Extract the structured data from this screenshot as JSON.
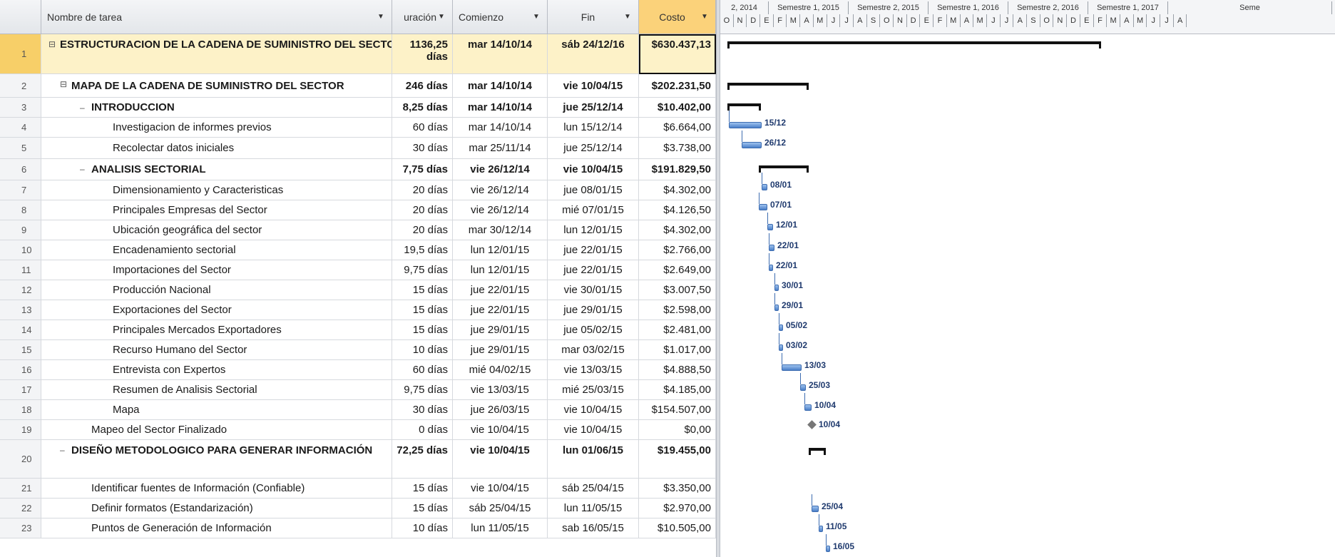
{
  "columns": {
    "id": "",
    "name": "Nombre de tarea",
    "duracion": "uración",
    "comienzo": "Comienzo",
    "fin": "Fin",
    "costo": "Costo"
  },
  "timeline": {
    "periods": [
      "2, 2014",
      "Semestre 1, 2015",
      "Semestre 2, 2015",
      "Semestre 1, 2016",
      "Semestre 2, 2016",
      "Semestre 1, 2017",
      "Seme"
    ],
    "months": [
      "O",
      "N",
      "D",
      "E",
      "F",
      "M",
      "A",
      "M",
      "J",
      "J",
      "A",
      "S",
      "O",
      "N",
      "D",
      "E",
      "F",
      "M",
      "A",
      "M",
      "J",
      "J",
      "A",
      "S",
      "O",
      "N",
      "D",
      "E",
      "F",
      "M",
      "A",
      "M",
      "J",
      "J",
      "A"
    ]
  },
  "rows": [
    {
      "id": "1",
      "name": "ESTRUCTURACION DE LA CADENA DE SUMINISTRO DEL SECTOR ALIMENTOS FRESCOS Y PROCESADOS",
      "dur": "1136,25 días",
      "start": "mar 14/10/14",
      "end": "sáb 24/12/16",
      "cost": "$630.437,13",
      "level": 0,
      "bold": true,
      "collapse": "⊟"
    },
    {
      "id": "2",
      "name": "MAPA DE LA CADENA DE SUMINISTRO DEL SECTOR",
      "dur": "246 días",
      "start": "mar 14/10/14",
      "end": "vie 10/04/15",
      "cost": "$202.231,50",
      "level": 1,
      "bold": true,
      "collapse": "⊟"
    },
    {
      "id": "3",
      "name": "INTRODUCCION",
      "dur": "8,25 días",
      "start": "mar 14/10/14",
      "end": "jue 25/12/14",
      "cost": "$10.402,00",
      "level": 2,
      "bold": true,
      "collapse": "–"
    },
    {
      "id": "4",
      "name": "Investigacion de informes previos",
      "dur": "60 días",
      "start": "mar 14/10/14",
      "end": "lun 15/12/14",
      "cost": "$6.664,00",
      "level": 3,
      "bold": false,
      "collapse": ""
    },
    {
      "id": "5",
      "name": "Recolectar datos iniciales",
      "dur": "30 días",
      "start": "mar 25/11/14",
      "end": "jue 25/12/14",
      "cost": "$3.738,00",
      "level": 3,
      "bold": false,
      "collapse": ""
    },
    {
      "id": "6",
      "name": "ANALISIS SECTORIAL",
      "dur": "7,75 días",
      "start": "vie 26/12/14",
      "end": "vie 10/04/15",
      "cost": "$191.829,50",
      "level": 2,
      "bold": true,
      "collapse": "–"
    },
    {
      "id": "7",
      "name": "Dimensionamiento y Caracteristicas",
      "dur": "20 días",
      "start": "vie 26/12/14",
      "end": "jue 08/01/15",
      "cost": "$4.302,00",
      "level": 3,
      "bold": false,
      "collapse": ""
    },
    {
      "id": "8",
      "name": "Principales Empresas del Sector",
      "dur": "20 días",
      "start": "vie 26/12/14",
      "end": "mié 07/01/15",
      "cost": "$4.126,50",
      "level": 3,
      "bold": false,
      "collapse": ""
    },
    {
      "id": "9",
      "name": "Ubicación geográfica del sector",
      "dur": "20 días",
      "start": "mar 30/12/14",
      "end": "lun 12/01/15",
      "cost": "$4.302,00",
      "level": 3,
      "bold": false,
      "collapse": ""
    },
    {
      "id": "10",
      "name": "Encadenamiento sectorial",
      "dur": "19,5 días",
      "start": "lun 12/01/15",
      "end": "jue 22/01/15",
      "cost": "$2.766,00",
      "level": 3,
      "bold": false,
      "collapse": ""
    },
    {
      "id": "11",
      "name": "Importaciones del Sector",
      "dur": "9,75 días",
      "start": "lun 12/01/15",
      "end": "jue 22/01/15",
      "cost": "$2.649,00",
      "level": 3,
      "bold": false,
      "collapse": ""
    },
    {
      "id": "12",
      "name": "Producción Nacional",
      "dur": "15 días",
      "start": "jue 22/01/15",
      "end": "vie 30/01/15",
      "cost": "$3.007,50",
      "level": 3,
      "bold": false,
      "collapse": ""
    },
    {
      "id": "13",
      "name": "Exportaciones del Sector",
      "dur": "15 días",
      "start": "jue 22/01/15",
      "end": "jue 29/01/15",
      "cost": "$2.598,00",
      "level": 3,
      "bold": false,
      "collapse": ""
    },
    {
      "id": "14",
      "name": "Principales Mercados Exportadores",
      "dur": "15 días",
      "start": "jue 29/01/15",
      "end": "jue 05/02/15",
      "cost": "$2.481,00",
      "level": 3,
      "bold": false,
      "collapse": ""
    },
    {
      "id": "15",
      "name": "Recurso Humano del Sector",
      "dur": "10 días",
      "start": "jue 29/01/15",
      "end": "mar 03/02/15",
      "cost": "$1.017,00",
      "level": 3,
      "bold": false,
      "collapse": ""
    },
    {
      "id": "16",
      "name": "Entrevista con Expertos",
      "dur": "60 días",
      "start": "mié 04/02/15",
      "end": "vie 13/03/15",
      "cost": "$4.888,50",
      "level": 3,
      "bold": false,
      "collapse": ""
    },
    {
      "id": "17",
      "name": "Resumen de Analisis Sectorial",
      "dur": "9,75 días",
      "start": "vie 13/03/15",
      "end": "mié 25/03/15",
      "cost": "$4.185,00",
      "level": 3,
      "bold": false,
      "collapse": ""
    },
    {
      "id": "18",
      "name": "Mapa",
      "dur": "30 días",
      "start": "jue 26/03/15",
      "end": "vie 10/04/15",
      "cost": "$154.507,00",
      "level": 3,
      "bold": false,
      "collapse": ""
    },
    {
      "id": "19",
      "name": "Mapeo del Sector Finalizado",
      "dur": "0 días",
      "start": "vie 10/04/15",
      "end": "vie 10/04/15",
      "cost": "$0,00",
      "level": 2,
      "bold": false,
      "collapse": ""
    },
    {
      "id": "20",
      "name": "DISEÑO METODOLOGICO PARA GENERAR INFORMACIÓN",
      "dur": "72,25 días",
      "start": "vie 10/04/15",
      "end": "lun 01/06/15",
      "cost": "$19.455,00",
      "level": 1,
      "bold": true,
      "collapse": "–"
    },
    {
      "id": "21",
      "name": "Identificar fuentes de Información (Confiable)",
      "dur": "15 días",
      "start": "vie 10/04/15",
      "end": "sáb 25/04/15",
      "cost": "$3.350,00",
      "level": 2,
      "bold": false,
      "collapse": ""
    },
    {
      "id": "22",
      "name": "Definir formatos (Estandarización)",
      "dur": "15 días",
      "start": "sáb 25/04/15",
      "end": "lun 11/05/15",
      "cost": "$2.970,00",
      "level": 2,
      "bold": false,
      "collapse": ""
    },
    {
      "id": "23",
      "name": "Puntos de Generación de Información",
      "dur": "10 días",
      "start": "lun 11/05/15",
      "end": "sab 16/05/15",
      "cost": "$10.505,00",
      "level": 2,
      "bold": false,
      "collapse": ""
    }
  ],
  "gantt_labels": [
    "15/12",
    "26/12",
    "08/01",
    "07/01",
    "12/01",
    "22/01",
    "22/01",
    "30/01",
    "29/01",
    "05/02",
    "03/02",
    "13/03",
    "25/03",
    "10/04",
    "10/04",
    "25/04",
    "11/05",
    "16/05"
  ]
}
